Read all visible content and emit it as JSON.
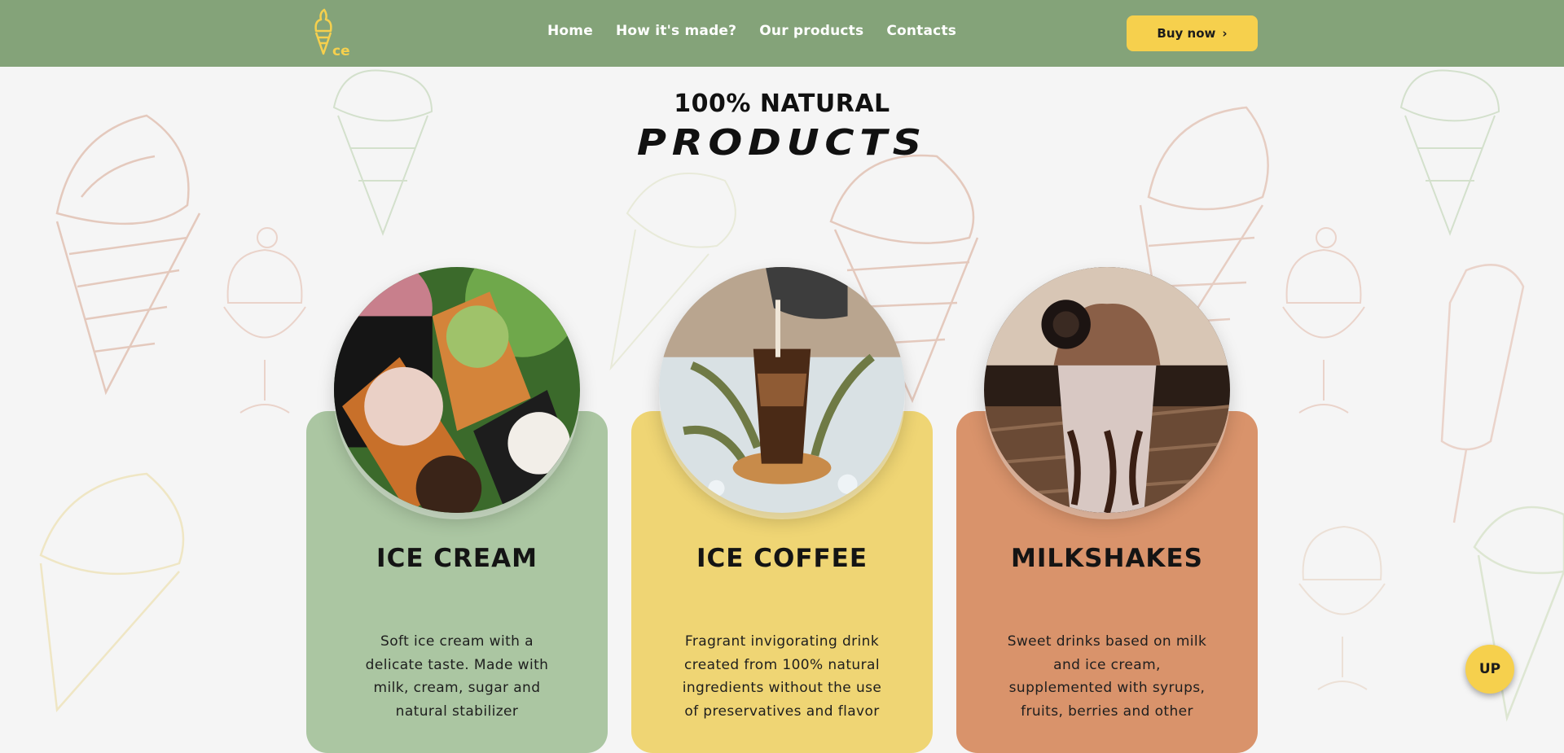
{
  "header": {
    "nav": [
      "Home",
      "How it's made?",
      "Our products",
      "Contacts"
    ],
    "buy_label": "Buy now",
    "buy_icon": "chevron-right-icon",
    "logo_icon": "ice-cream-cone-logo",
    "bg_color": "#84a379",
    "accent_color": "#f6d04d"
  },
  "heading": {
    "sub": "100% NATURAL",
    "main": "PRODUCTS"
  },
  "products": [
    {
      "title": "ICE CREAM",
      "description": "Soft ice cream with a\ndelicate taste. Made with\nmilk, cream, sugar and\nnatural stabilizer",
      "color": "#abc6a2"
    },
    {
      "title": "ICE COFFEE",
      "description": "Fragrant invigorating drink\ncreated from 100% natural\ningredients without the use\nof preservatives and flavor",
      "color": "#efd574"
    },
    {
      "title": "MILKSHAKES",
      "description": "Sweet drinks based on milk\nand ice cream,\nsupplemented with syrups,\nfruits, berries and other",
      "color": "#d9936b"
    }
  ],
  "up_label": "UP"
}
